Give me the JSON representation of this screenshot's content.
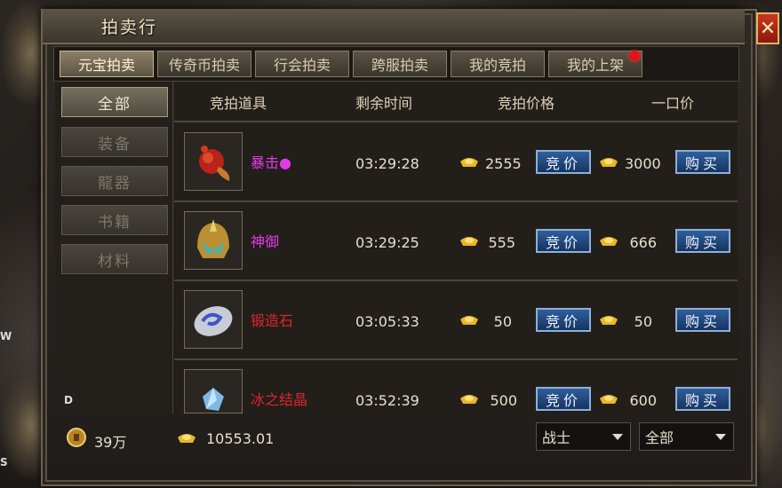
{
  "window": {
    "title": "拍卖行",
    "close_label": "✕"
  },
  "tabs": [
    {
      "label": "元宝拍卖",
      "active": true
    },
    {
      "label": "传奇币拍卖",
      "active": false
    },
    {
      "label": "行会拍卖",
      "active": false
    },
    {
      "label": "跨服拍卖",
      "active": false
    },
    {
      "label": "我的竞拍",
      "active": false
    },
    {
      "label": "我的上架",
      "active": false,
      "notification": true
    }
  ],
  "categories": [
    {
      "label": "全部",
      "active": true
    },
    {
      "label": "装备",
      "active": false
    },
    {
      "label": "龍器",
      "active": false
    },
    {
      "label": "书籍",
      "active": false
    },
    {
      "label": "材料",
      "active": false
    }
  ],
  "table": {
    "headers": [
      "竞拍道具",
      "剩余时间",
      "竞拍价格",
      "一口价"
    ],
    "rows": [
      {
        "name": "暴击●",
        "name_color": "#e33be8",
        "icon": "red-dragon-charm-icon",
        "time": "03:29:28",
        "bid_price": "2555",
        "bid_label": "竞价",
        "buyout_price": "3000",
        "buy_label": "购买"
      },
      {
        "name": "神御",
        "name_color": "#e33be8",
        "icon": "golden-helmet-icon",
        "time": "03:29:25",
        "bid_price": "555",
        "bid_label": "竞价",
        "buyout_price": "666",
        "buy_label": "购买"
      },
      {
        "name": "锻造石",
        "name_color": "#e0262a",
        "icon": "forging-stone-icon",
        "time": "03:05:33",
        "bid_price": "50",
        "bid_label": "竞价",
        "buyout_price": "50",
        "buy_label": "购买"
      },
      {
        "name": "冰之结晶",
        "name_color": "#e0262a",
        "icon": "ice-crystal-icon",
        "time": "03:52:39",
        "bid_price": "500",
        "bid_label": "竞价",
        "buyout_price": "600",
        "buy_label": "购买"
      }
    ]
  },
  "footer": {
    "coins": "39万",
    "gold_ingots": "10553.01",
    "class_filter": "战士",
    "category_filter": "全部"
  },
  "side_labels": {
    "left_w": "W",
    "left_s": "S",
    "inner_d": "D"
  },
  "colors": {
    "gold": "#e9b52a",
    "button_blue": "#2f5f9c",
    "notification": "#e0141a"
  }
}
